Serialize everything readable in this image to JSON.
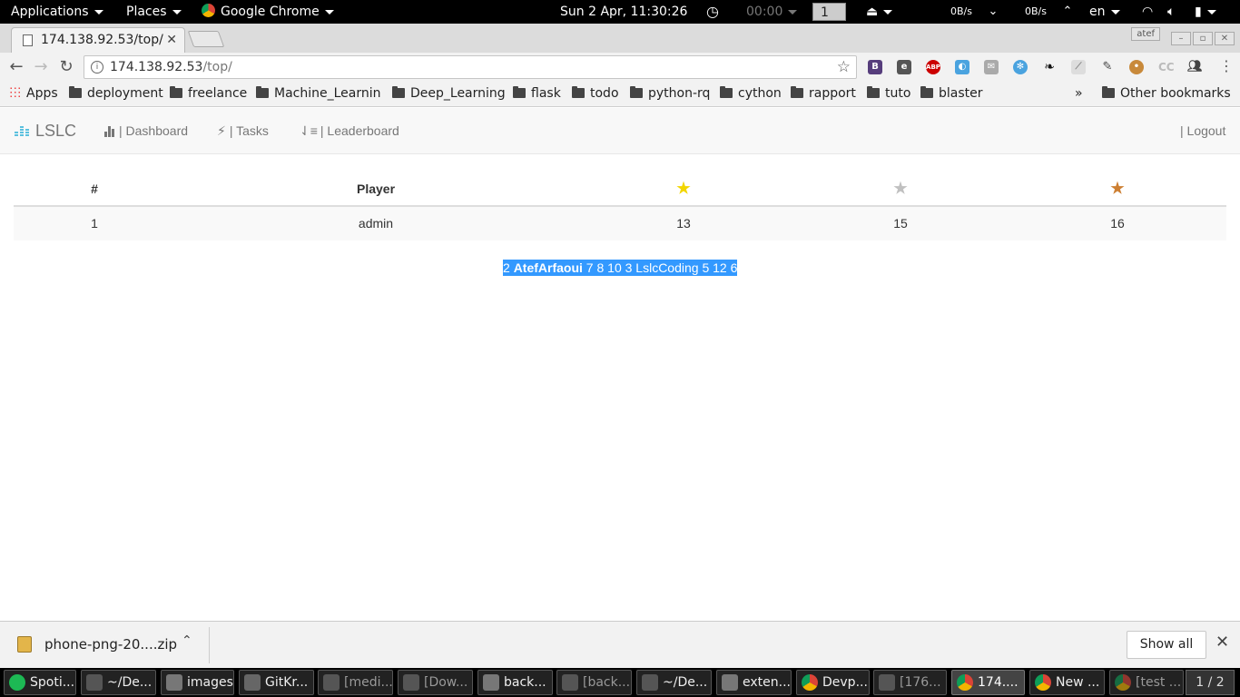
{
  "system_bar": {
    "applications": "Applications",
    "places": "Places",
    "app_name": "Google Chrome",
    "clock": "Sun  2 Apr, 11:30:26",
    "timer": "00:00",
    "workspace": "1",
    "net_down": "0B/s",
    "net_up": "0B/s",
    "lang": "en"
  },
  "browser": {
    "tab_title": "174.138.92.53/top/",
    "profile": "atef",
    "url_host": "174.138.92.53",
    "url_path": "/top/"
  },
  "bookmarks": {
    "apps": "Apps",
    "items": [
      "deployment",
      "freelance",
      "Machine_Learning",
      "Deep_Learning",
      "flask",
      "todo",
      "python-rq",
      "cython",
      "rapport",
      "tuto",
      "blaster"
    ],
    "overflow": "»",
    "other": "Other bookmarks"
  },
  "nav": {
    "brand": "LSLC",
    "dashboard": "| Dashboard",
    "tasks": "| Tasks",
    "leaderboard": "| Leaderboard",
    "logout": "| Logout"
  },
  "leaderboard": {
    "headers": {
      "rank": "#",
      "player": "Player",
      "gold": "★",
      "silver": "★",
      "bronze": "★"
    },
    "star_colors": {
      "gold": "#f2d600",
      "silver": "#c0c0c0",
      "bronze": "#cd7f32"
    },
    "rows": [
      {
        "rank": "1",
        "player": "admin",
        "gold": "13",
        "silver": "15",
        "bronze": "16"
      }
    ]
  },
  "selected_text": {
    "before": "2 ",
    "bold": "AtefArfaoui",
    "after": " 7 8 10 3 LslcCoding 5 12 6"
  },
  "download": {
    "file": "phone-png-20....zip",
    "show_all": "Show all"
  },
  "taskbar": {
    "items": [
      "Spoti...",
      "~/De...",
      "images",
      "GitKr...",
      "[medi...",
      "[Dow...",
      "back...",
      "[back...",
      "~/De...",
      "exten...",
      "Devp...",
      "[176...",
      "174....",
      "New ...",
      "[test ..."
    ],
    "pager": "1 / 2"
  }
}
